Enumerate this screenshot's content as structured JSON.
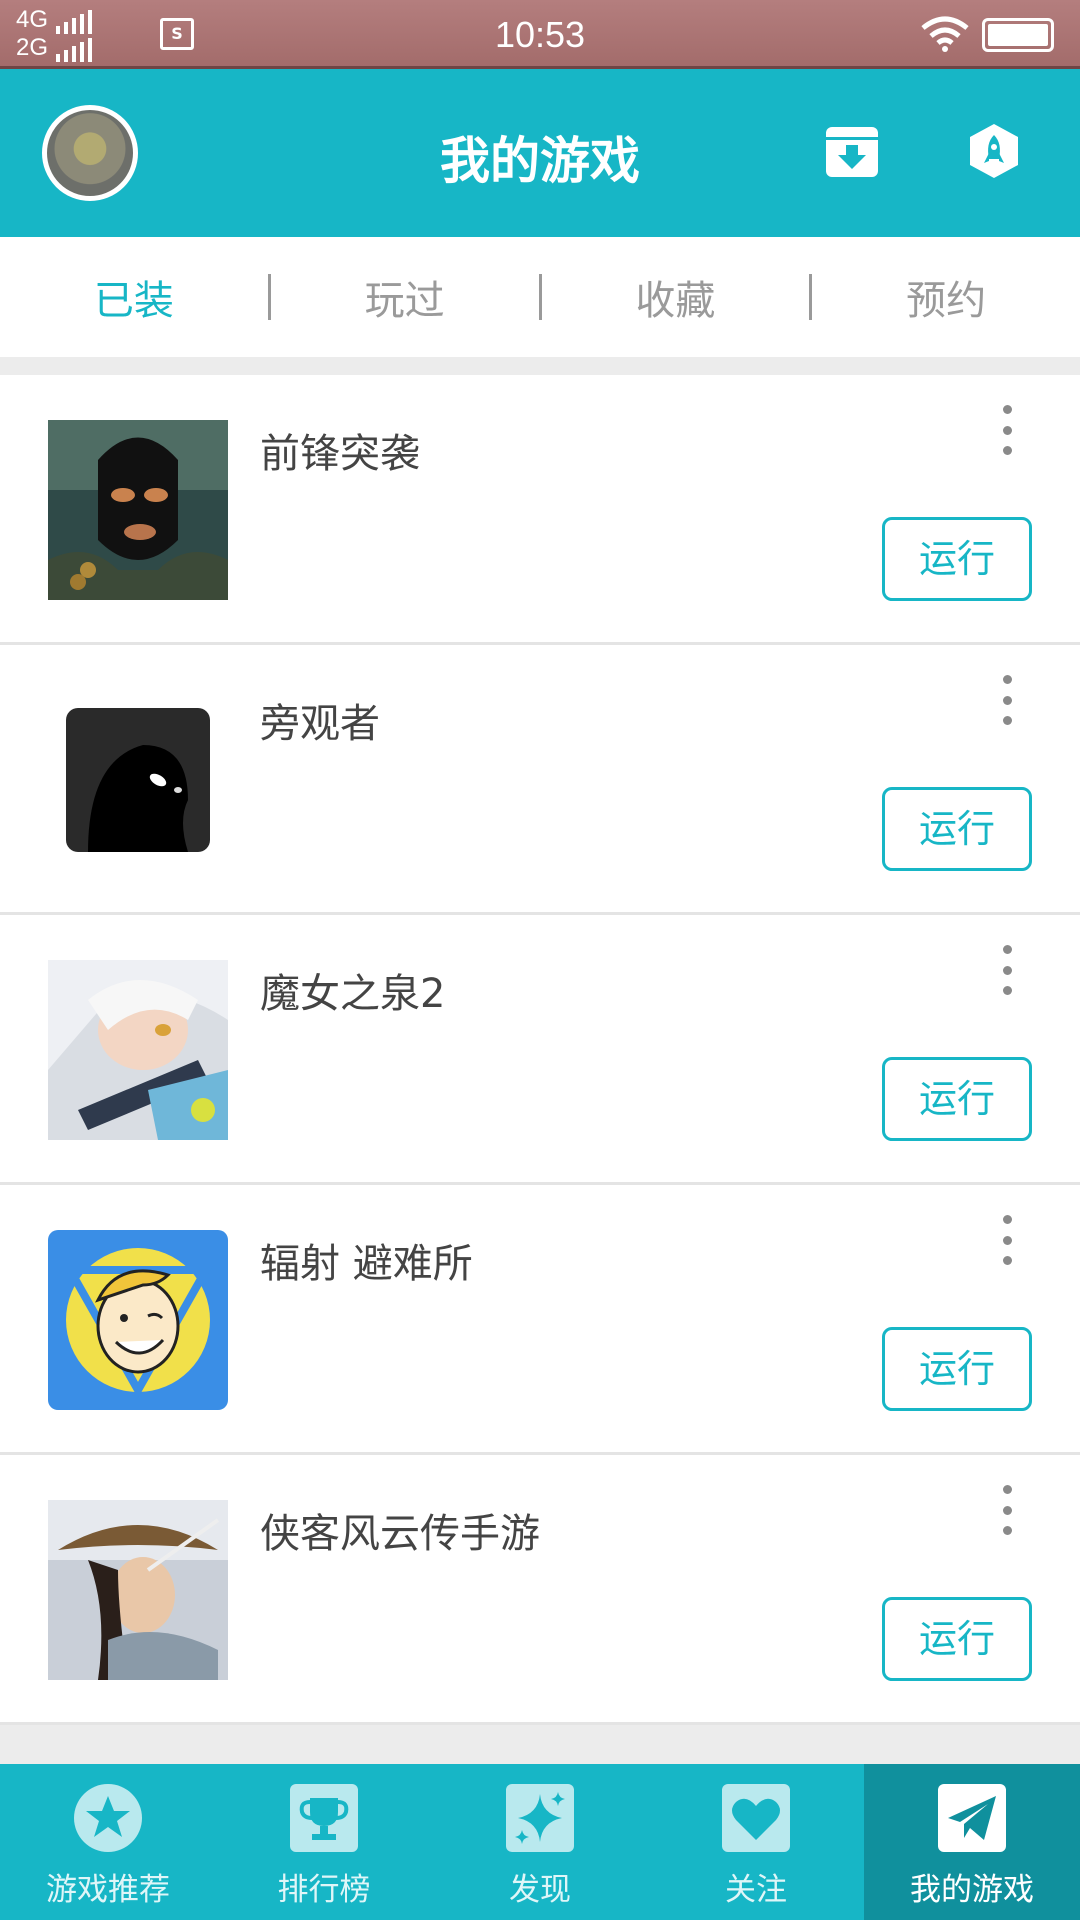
{
  "status_bar": {
    "network_top": "4G",
    "network_bottom": "2G",
    "time": "10:53"
  },
  "header": {
    "title": "我的游戏",
    "left_icon": "avatar",
    "right_icons": [
      "download-box-icon",
      "rocket-icon"
    ]
  },
  "tabs": [
    {
      "label": "已装",
      "active": true
    },
    {
      "label": "玩过",
      "active": false
    },
    {
      "label": "收藏",
      "active": false
    },
    {
      "label": "预约",
      "active": false
    }
  ],
  "games": [
    {
      "name": "前锋突袭",
      "action": "运行",
      "icon": "masked-soldier"
    },
    {
      "name": "旁观者",
      "action": "运行",
      "icon": "dark-silhouette"
    },
    {
      "name": "魔女之泉2",
      "action": "运行",
      "icon": "white-haired-girl"
    },
    {
      "name": "辐射 避难所",
      "action": "运行",
      "icon": "vault-boy"
    },
    {
      "name": "侠客风云传手游",
      "action": "运行",
      "icon": "straw-hat-swordsman"
    }
  ],
  "bottom_nav": [
    {
      "label": "游戏推荐",
      "icon": "star-icon",
      "active": false
    },
    {
      "label": "排行榜",
      "icon": "trophy-icon",
      "active": false
    },
    {
      "label": "发现",
      "icon": "sparkle-icon",
      "active": false
    },
    {
      "label": "关注",
      "icon": "heart-icon",
      "active": false
    },
    {
      "label": "我的游戏",
      "icon": "paper-plane-icon",
      "active": true
    }
  ],
  "colors": {
    "accent": "#17b6c6",
    "accent_dark": "#10909d",
    "status_bar": "#a36c6b",
    "text_muted": "#9a9a9a"
  }
}
